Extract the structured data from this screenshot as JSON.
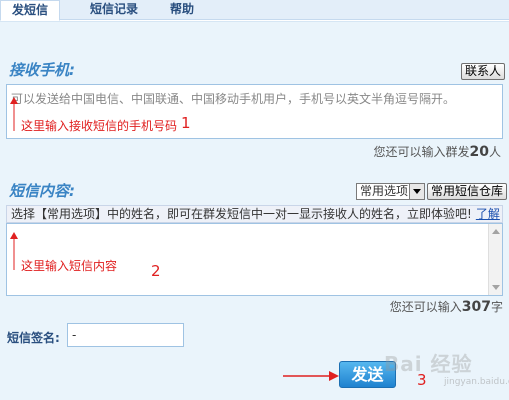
{
  "tabs": [
    {
      "label": "发短信",
      "active": true
    },
    {
      "label": "短信记录",
      "active": false
    },
    {
      "label": "帮助",
      "active": false
    }
  ],
  "receiver": {
    "title": "接收手机:",
    "contacts_button": "联系人",
    "placeholder": "可以发送给中国电信、中国联通、中国移动手机用户，手机号以英文半角逗号隔开。",
    "counter_prefix": "您还可以输入群发",
    "counter_value": "20",
    "counter_suffix": "人"
  },
  "message": {
    "title": "短信内容:",
    "select_value": "常用选项",
    "library_button": "常用短信仓库",
    "hint": "选择【常用选项】中的姓名，即可在群发短信中一对一显示接收人的姓名，立即体验吧!",
    "hint_link": "了解",
    "counter_prefix": "您还可以输入",
    "counter_value": "307",
    "counter_suffix": "字"
  },
  "signature": {
    "label": "短信签名:",
    "value": "-"
  },
  "send_button": "发送",
  "annotations": {
    "phone_note": "这里输入接收短信的手机号码",
    "phone_step": "1",
    "content_note": "这里输入短信内容",
    "content_step": "2",
    "send_step": "3",
    "color": "#e02020"
  },
  "watermark": {
    "main": "Bai 经验",
    "sub": "jingyan.baidu.com"
  },
  "colors": {
    "accent": "#3a84c4",
    "tab_bar": "#e3eef9",
    "panel": "#eaf4fb",
    "send_button": "#2a8fd6"
  }
}
